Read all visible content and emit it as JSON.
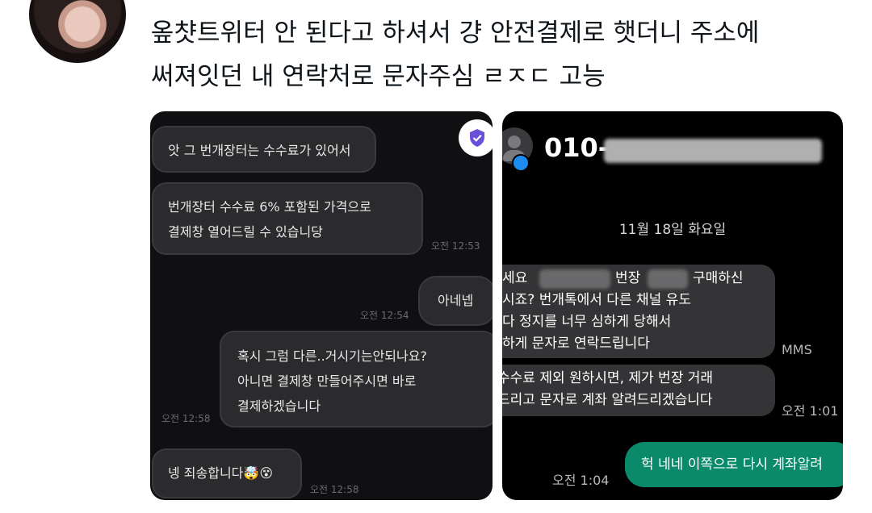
{
  "tweet": {
    "line1": "옾챳트위터 안 된다고 하셔서 걍 안전결제로 햇더니 주소에",
    "line2": "써져잇던 내 연락처로 문자주심 ㄹㅈㄷ 고능"
  },
  "chat_left": {
    "bubbles": [
      {
        "text": "앗 그 번개장터는 수수료가 있어서"
      },
      {
        "line1": "번개장터 수수료 6% 포함된 가격으로",
        "line2": "결제창 열어드릴 수 있습니당",
        "time": "오전 12:53"
      },
      {
        "text": "아네넵",
        "time": "오전 12:54"
      },
      {
        "line1": "혹시 그럼 다른..거시기는안되나요?",
        "line2": "아니면 결제창 만들어주시면 바로",
        "line3": "결제하겠습니다",
        "time": "오전 12:58"
      },
      {
        "text": "넹 죄송합니다🤯😵",
        "time": "오전 12:58"
      }
    ],
    "icon": "shield-check-icon"
  },
  "chat_right": {
    "contact": "010-",
    "date": "11월 18일 화요일",
    "msg1": {
      "line1a": "세요",
      "line1b": "번장",
      "line1c": "구매하신",
      "line2": "시죠? 번개톡에서 다른 채널 유도",
      "line3": "다 정지를 너무 심하게 당해서",
      "line4": "하게 문자로 연락드립니다",
      "tag": "MMS"
    },
    "msg2": {
      "line1": "수수료 제외 원하시면, 제가 번장 거래",
      "line2": "드리고 문자로 계좌 알려드리겠습니다",
      "time": "오전 1:01"
    },
    "reply": {
      "text": "헉 네네 이쪽으로 다시 계좌알려",
      "time": "오전 1:04"
    },
    "colors": {
      "accent": "#0a8a6a",
      "badge": "#1d8cf0"
    }
  }
}
